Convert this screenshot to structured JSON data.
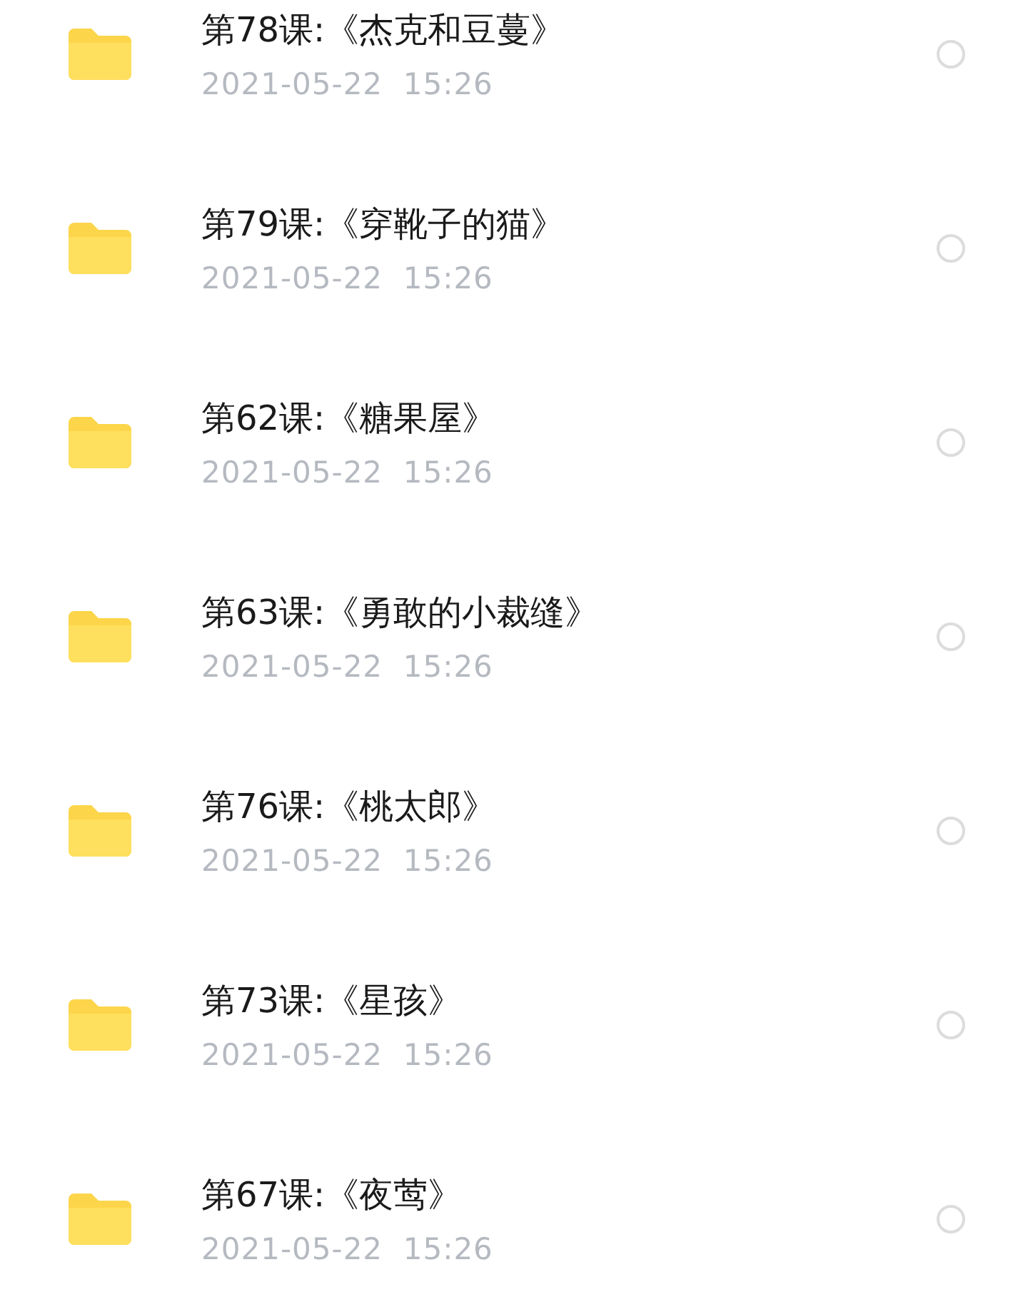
{
  "files": [
    {
      "title": "第78课:《杰克和豆蔓》",
      "date": "2021-05-22  15:26",
      "selected": false
    },
    {
      "title": "第79课:《穿靴子的猫》",
      "date": "2021-05-22  15:26",
      "selected": false
    },
    {
      "title": "第62课:《糖果屋》",
      "date": "2021-05-22  15:26",
      "selected": false
    },
    {
      "title": "第63课:《勇敢的小裁缝》",
      "date": "2021-05-22  15:26",
      "selected": false
    },
    {
      "title": "第76课:《桃太郎》",
      "date": "2021-05-22  15:26",
      "selected": false
    },
    {
      "title": "第73课:《星孩》",
      "date": "2021-05-22  15:26",
      "selected": false
    },
    {
      "title": "第67课:《夜莺》",
      "date": "2021-05-22  15:26",
      "selected": false
    }
  ]
}
